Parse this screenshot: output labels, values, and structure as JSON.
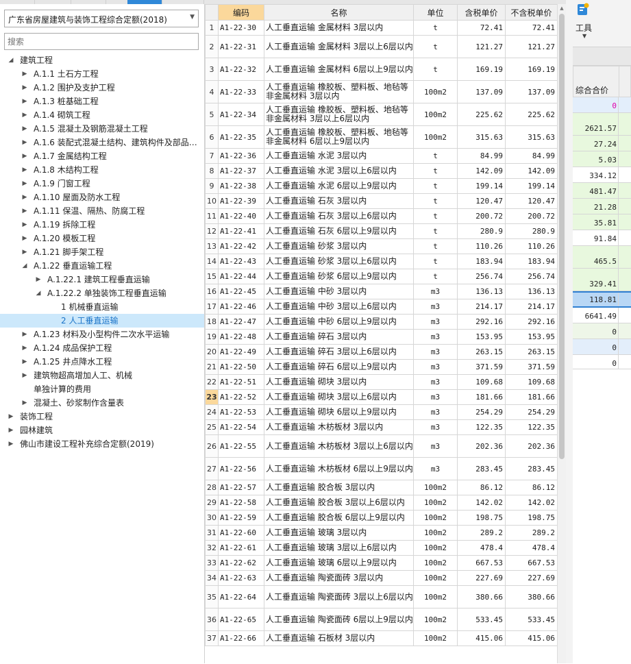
{
  "dropdown": {
    "value": "广东省房屋建筑与装饰工程综合定额(2018)"
  },
  "search": {
    "placeholder": "搜索"
  },
  "tree": [
    {
      "label": "建筑工程",
      "level": 0,
      "state": "expanded"
    },
    {
      "label": "A.1.1 土石方工程",
      "level": 1,
      "state": "collapsed"
    },
    {
      "label": "A.1.2 围护及支护工程",
      "level": 1,
      "state": "collapsed"
    },
    {
      "label": "A.1.3 桩基础工程",
      "level": 1,
      "state": "collapsed"
    },
    {
      "label": "A.1.4 砌筑工程",
      "level": 1,
      "state": "collapsed"
    },
    {
      "label": "A.1.5 混凝土及钢筋混凝土工程",
      "level": 1,
      "state": "collapsed"
    },
    {
      "label": "A.1.6 装配式混凝土结构、建筑构件及部品…",
      "level": 1,
      "state": "collapsed"
    },
    {
      "label": "A.1.7 金属结构工程",
      "level": 1,
      "state": "collapsed"
    },
    {
      "label": "A.1.8 木结构工程",
      "level": 1,
      "state": "collapsed"
    },
    {
      "label": "A.1.9 门窗工程",
      "level": 1,
      "state": "collapsed"
    },
    {
      "label": "A.1.10 屋面及防水工程",
      "level": 1,
      "state": "collapsed"
    },
    {
      "label": "A.1.11 保温、隔热、防腐工程",
      "level": 1,
      "state": "collapsed"
    },
    {
      "label": "A.1.19 拆除工程",
      "level": 1,
      "state": "collapsed"
    },
    {
      "label": "A.1.20 模板工程",
      "level": 1,
      "state": "collapsed"
    },
    {
      "label": "A.1.21 脚手架工程",
      "level": 1,
      "state": "collapsed"
    },
    {
      "label": "A.1.22 垂直运输工程",
      "level": 1,
      "state": "expanded"
    },
    {
      "label": "A.1.22.1 建筑工程垂直运输",
      "level": 2,
      "state": "collapsed"
    },
    {
      "label": "A.1.22.2 单独装饰工程垂直运输",
      "level": 2,
      "state": "expanded"
    },
    {
      "label": "1 机械垂直运输",
      "level": 3,
      "state": "leaf"
    },
    {
      "label": "2 人工垂直运输",
      "level": 3,
      "state": "leaf",
      "selected": true
    },
    {
      "label": "A.1.23 材料及小型构件二次水平运输",
      "level": 1,
      "state": "collapsed"
    },
    {
      "label": "A.1.24 成品保护工程",
      "level": 1,
      "state": "collapsed"
    },
    {
      "label": "A.1.25 井点降水工程",
      "level": 1,
      "state": "collapsed"
    },
    {
      "label": "建筑物超高增加人工、机械",
      "level": 1,
      "state": "collapsed"
    },
    {
      "label": "单独计算的费用",
      "level": 1,
      "state": "leaf"
    },
    {
      "label": "混凝土、砂浆制作含量表",
      "level": 1,
      "state": "collapsed"
    },
    {
      "label": "装饰工程",
      "level": 0,
      "state": "collapsed"
    },
    {
      "label": "园林建筑",
      "level": 0,
      "state": "collapsed"
    },
    {
      "label": "佛山市建设工程补充综合定额(2019)",
      "level": 0,
      "state": "collapsed"
    }
  ],
  "grid": {
    "headers": {
      "code": "编码",
      "name": "名称",
      "unit": "单位",
      "tax_incl": "含税单价",
      "tax_excl": "不含税单价"
    },
    "current_row": 23,
    "rows": [
      {
        "no": "1",
        "code": "A1-22-30",
        "name": "人工垂直运输 金属材料 3层以内",
        "unit": "t",
        "p1": "72.41",
        "p2": "72.41",
        "tall": false
      },
      {
        "no": "2",
        "code": "A1-22-31",
        "name": "人工垂直运输 金属材料 3层以上6层以内",
        "unit": "t",
        "p1": "121.27",
        "p2": "121.27",
        "tall": true
      },
      {
        "no": "3",
        "code": "A1-22-32",
        "name": "人工垂直运输 金属材料 6层以上9层以内",
        "unit": "t",
        "p1": "169.19",
        "p2": "169.19",
        "tall": true
      },
      {
        "no": "4",
        "code": "A1-22-33",
        "name": "人工垂直运输 橡胶板、塑料板、地毡等非金属材料 3层以内",
        "unit": "100m2",
        "p1": "137.09",
        "p2": "137.09",
        "tall": true
      },
      {
        "no": "5",
        "code": "A1-22-34",
        "name": "人工垂直运输 橡胶板、塑料板、地毡等非金属材料 3层以上6层以内",
        "unit": "100m2",
        "p1": "225.62",
        "p2": "225.62",
        "tall": true
      },
      {
        "no": "6",
        "code": "A1-22-35",
        "name": "人工垂直运输 橡胶板、塑料板、地毡等非金属材料 6层以上9层以内",
        "unit": "100m2",
        "p1": "315.63",
        "p2": "315.63",
        "tall": true
      },
      {
        "no": "7",
        "code": "A1-22-36",
        "name": "人工垂直运输 水泥 3层以内",
        "unit": "t",
        "p1": "84.99",
        "p2": "84.99",
        "tall": false
      },
      {
        "no": "8",
        "code": "A1-22-37",
        "name": "人工垂直运输 水泥 3层以上6层以内",
        "unit": "t",
        "p1": "142.09",
        "p2": "142.09",
        "tall": false
      },
      {
        "no": "9",
        "code": "A1-22-38",
        "name": "人工垂直运输 水泥 6层以上9层以内",
        "unit": "t",
        "p1": "199.14",
        "p2": "199.14",
        "tall": false
      },
      {
        "no": "10",
        "code": "A1-22-39",
        "name": "人工垂直运输 石灰 3层以内",
        "unit": "t",
        "p1": "120.47",
        "p2": "120.47",
        "tall": false
      },
      {
        "no": "11",
        "code": "A1-22-40",
        "name": "人工垂直运输 石灰 3层以上6层以内",
        "unit": "t",
        "p1": "200.72",
        "p2": "200.72",
        "tall": false
      },
      {
        "no": "12",
        "code": "A1-22-41",
        "name": "人工垂直运输 石灰 6层以上9层以内",
        "unit": "t",
        "p1": "280.9",
        "p2": "280.9",
        "tall": false
      },
      {
        "no": "13",
        "code": "A1-22-42",
        "name": "人工垂直运输 砂浆 3层以内",
        "unit": "t",
        "p1": "110.26",
        "p2": "110.26",
        "tall": false
      },
      {
        "no": "14",
        "code": "A1-22-43",
        "name": "人工垂直运输 砂浆 3层以上6层以内",
        "unit": "t",
        "p1": "183.94",
        "p2": "183.94",
        "tall": false
      },
      {
        "no": "15",
        "code": "A1-22-44",
        "name": "人工垂直运输 砂浆 6层以上9层以内",
        "unit": "t",
        "p1": "256.74",
        "p2": "256.74",
        "tall": false
      },
      {
        "no": "16",
        "code": "A1-22-45",
        "name": "人工垂直运输 中砂 3层以内",
        "unit": "m3",
        "p1": "136.13",
        "p2": "136.13",
        "tall": false
      },
      {
        "no": "17",
        "code": "A1-22-46",
        "name": "人工垂直运输 中砂 3层以上6层以内",
        "unit": "m3",
        "p1": "214.17",
        "p2": "214.17",
        "tall": false
      },
      {
        "no": "18",
        "code": "A1-22-47",
        "name": "人工垂直运输 中砂 6层以上9层以内",
        "unit": "m3",
        "p1": "292.16",
        "p2": "292.16",
        "tall": false
      },
      {
        "no": "19",
        "code": "A1-22-48",
        "name": "人工垂直运输 碎石 3层以内",
        "unit": "m3",
        "p1": "153.95",
        "p2": "153.95",
        "tall": false
      },
      {
        "no": "20",
        "code": "A1-22-49",
        "name": "人工垂直运输 碎石 3层以上6层以内",
        "unit": "m3",
        "p1": "263.15",
        "p2": "263.15",
        "tall": false
      },
      {
        "no": "21",
        "code": "A1-22-50",
        "name": "人工垂直运输 碎石 6层以上9层以内",
        "unit": "m3",
        "p1": "371.59",
        "p2": "371.59",
        "tall": false
      },
      {
        "no": "22",
        "code": "A1-22-51",
        "name": "人工垂直运输 砌块 3层以内",
        "unit": "m3",
        "p1": "109.68",
        "p2": "109.68",
        "tall": false
      },
      {
        "no": "23",
        "code": "A1-22-52",
        "name": "人工垂直运输 砌块 3层以上6层以内",
        "unit": "m3",
        "p1": "181.66",
        "p2": "181.66",
        "tall": false
      },
      {
        "no": "24",
        "code": "A1-22-53",
        "name": "人工垂直运输 砌块 6层以上9层以内",
        "unit": "m3",
        "p1": "254.29",
        "p2": "254.29",
        "tall": false
      },
      {
        "no": "25",
        "code": "A1-22-54",
        "name": "人工垂直运输 木枋板材 3层以内",
        "unit": "m3",
        "p1": "122.35",
        "p2": "122.35",
        "tall": false
      },
      {
        "no": "26",
        "code": "A1-22-55",
        "name": "人工垂直运输 木枋板材 3层以上6层以内",
        "unit": "m3",
        "p1": "202.36",
        "p2": "202.36",
        "tall": true
      },
      {
        "no": "27",
        "code": "A1-22-56",
        "name": "人工垂直运输 木枋板材 6层以上9层以内",
        "unit": "m3",
        "p1": "283.45",
        "p2": "283.45",
        "tall": true
      },
      {
        "no": "28",
        "code": "A1-22-57",
        "name": "人工垂直运输 胶合板 3层以内",
        "unit": "100m2",
        "p1": "86.12",
        "p2": "86.12",
        "tall": false
      },
      {
        "no": "29",
        "code": "A1-22-58",
        "name": "人工垂直运输 胶合板 3层以上6层以内",
        "unit": "100m2",
        "p1": "142.02",
        "p2": "142.02",
        "tall": false
      },
      {
        "no": "30",
        "code": "A1-22-59",
        "name": "人工垂直运输 胶合板 6层以上9层以内",
        "unit": "100m2",
        "p1": "198.75",
        "p2": "198.75",
        "tall": false
      },
      {
        "no": "31",
        "code": "A1-22-60",
        "name": "人工垂直运输 玻璃 3层以内",
        "unit": "100m2",
        "p1": "289.2",
        "p2": "289.2",
        "tall": false
      },
      {
        "no": "32",
        "code": "A1-22-61",
        "name": "人工垂直运输 玻璃 3层以上6层以内",
        "unit": "100m2",
        "p1": "478.4",
        "p2": "478.4",
        "tall": false
      },
      {
        "no": "33",
        "code": "A1-22-62",
        "name": "人工垂直运输 玻璃 6层以上9层以内",
        "unit": "100m2",
        "p1": "667.53",
        "p2": "667.53",
        "tall": false
      },
      {
        "no": "34",
        "code": "A1-22-63",
        "name": "人工垂直运输 陶瓷面砖 3层以内",
        "unit": "100m2",
        "p1": "227.69",
        "p2": "227.69",
        "tall": false
      },
      {
        "no": "35",
        "code": "A1-22-64",
        "name": "人工垂直运输 陶瓷面砖 3层以上6层以内",
        "unit": "100m2",
        "p1": "380.66",
        "p2": "380.66",
        "tall": true
      },
      {
        "no": "36",
        "code": "A1-22-65",
        "name": "人工垂直运输 陶瓷面砖 6层以上9层以内",
        "unit": "100m2",
        "p1": "533.45",
        "p2": "533.45",
        "tall": true
      },
      {
        "no": "37",
        "code": "A1-22-66",
        "name": "人工垂直运输 石板材 3层以内",
        "unit": "100m2",
        "p1": "415.06",
        "p2": "415.06",
        "tall": false
      }
    ]
  },
  "toolbar": {
    "tools_label": "工具",
    "tools_icon": "tools-icon"
  },
  "right_grid": {
    "header": "综合合价",
    "cells": [
      {
        "value": "0",
        "bg": "#e3eefb",
        "color": "#e000a8",
        "h": 23
      },
      {
        "value": "2621.57",
        "bg": "#e8f8de",
        "color": "#222222",
        "h": 33
      },
      {
        "value": "27.24",
        "bg": "#e8f8de",
        "color": "#222222",
        "h": 23
      },
      {
        "value": "5.03",
        "bg": "#e8f8de",
        "color": "#222222",
        "h": 23
      },
      {
        "value": "334.12",
        "bg": "#ffffff",
        "color": "#222222",
        "h": 23
      },
      {
        "value": "481.47",
        "bg": "#e8f8de",
        "color": "#222222",
        "h": 23
      },
      {
        "value": "21.28",
        "bg": "#e8f8de",
        "color": "#222222",
        "h": 23
      },
      {
        "value": "35.81",
        "bg": "#e8f8de",
        "color": "#222222",
        "h": 23
      },
      {
        "value": "91.84",
        "bg": "#ffffff",
        "color": "#222222",
        "h": 23
      },
      {
        "value": "465.5",
        "bg": "#e8f8de",
        "color": "#222222",
        "h": 33
      },
      {
        "value": "329.41",
        "bg": "#e8f8de",
        "color": "#222222",
        "h": 33
      },
      {
        "value": "118.81",
        "bg": "#b9d7f5",
        "color": "#222222",
        "h": 24,
        "sel": true
      },
      {
        "value": "6641.49",
        "bg": "#ffffff",
        "color": "#222222",
        "h": 23
      },
      {
        "value": "0",
        "bg": "#eef6e8",
        "color": "#222222",
        "h": 23
      },
      {
        "value": "0",
        "bg": "#e3eefb",
        "color": "#222222",
        "h": 23
      },
      {
        "value": "0",
        "bg": "#ffffff",
        "color": "#222222",
        "h": 23
      }
    ]
  }
}
